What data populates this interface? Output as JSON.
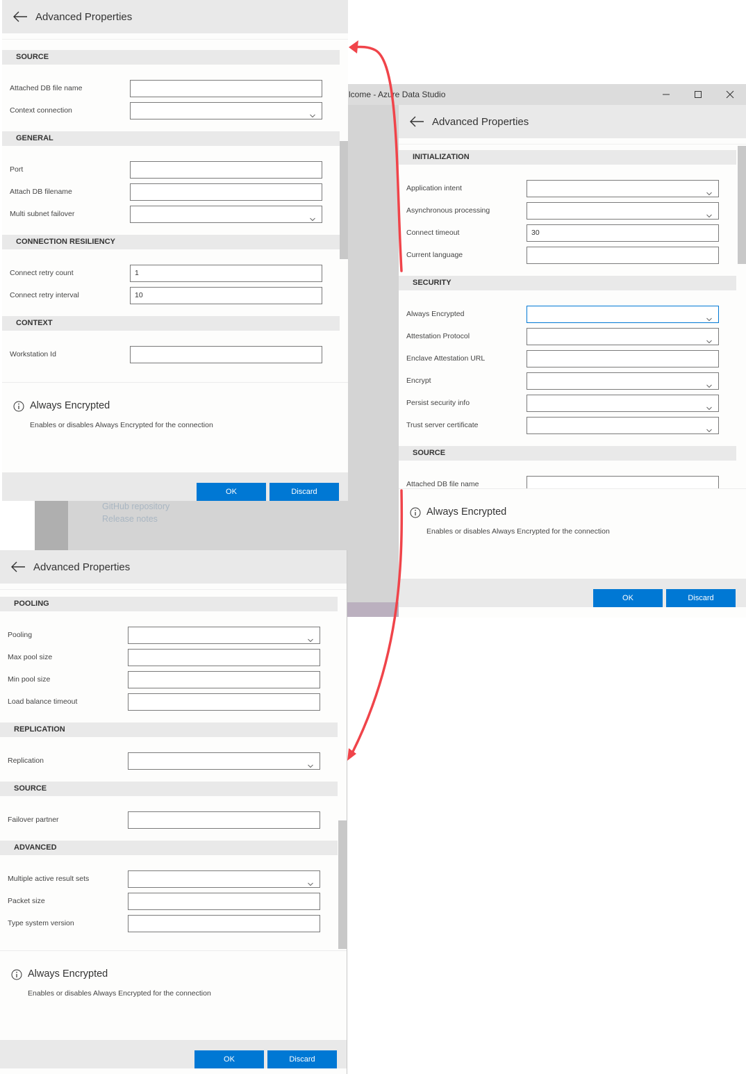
{
  "window": {
    "title": "lcome - Azure Data Studio",
    "controls": [
      "minimize",
      "maximize",
      "close"
    ]
  },
  "background_links": [
    "GitHub repository",
    "Release notes"
  ],
  "panel_title": "Advanced Properties",
  "colors": {
    "accent": "#0078d4",
    "arrow": "#f0444a",
    "section_bg": "#e9e9e9"
  },
  "panels": [
    {
      "id": "top-left",
      "title": "Advanced Properties",
      "sections": [
        {
          "name": "SOURCE",
          "fields": [
            {
              "label": "Attached DB file name",
              "type": "text",
              "value": ""
            },
            {
              "label": "Context connection",
              "type": "select",
              "value": ""
            }
          ]
        },
        {
          "name": "GENERAL",
          "fields": [
            {
              "label": "Port",
              "type": "text",
              "value": ""
            },
            {
              "label": "Attach DB filename",
              "type": "text",
              "value": ""
            },
            {
              "label": "Multi subnet failover",
              "type": "select",
              "value": ""
            }
          ]
        },
        {
          "name": "CONNECTION RESILIENCY",
          "fields": [
            {
              "label": "Connect retry count",
              "type": "text",
              "value": "1"
            },
            {
              "label": "Connect retry interval",
              "type": "text",
              "value": "10"
            }
          ]
        },
        {
          "name": "CONTEXT",
          "fields": [
            {
              "label": "Workstation Id",
              "type": "text",
              "value": ""
            }
          ]
        }
      ],
      "info": {
        "title": "Always Encrypted",
        "description": "Enables or disables Always Encrypted for the connection"
      },
      "ok_label": "OK",
      "discard_label": "Discard"
    },
    {
      "id": "right",
      "title": "Advanced Properties",
      "sections": [
        {
          "name": "INITIALIZATION",
          "fields": [
            {
              "label": "Application intent",
              "type": "select",
              "value": ""
            },
            {
              "label": "Asynchronous processing",
              "type": "select",
              "value": ""
            },
            {
              "label": "Connect timeout",
              "type": "text",
              "value": "30"
            },
            {
              "label": "Current language",
              "type": "text",
              "value": ""
            }
          ]
        },
        {
          "name": "SECURITY",
          "fields": [
            {
              "label": "Always Encrypted",
              "type": "select",
              "value": "",
              "focused": true
            },
            {
              "label": "Attestation Protocol",
              "type": "select",
              "value": ""
            },
            {
              "label": "Enclave Attestation URL",
              "type": "text",
              "value": ""
            },
            {
              "label": "Encrypt",
              "type": "select",
              "value": ""
            },
            {
              "label": "Persist security info",
              "type": "select",
              "value": ""
            },
            {
              "label": "Trust server certificate",
              "type": "select",
              "value": ""
            }
          ]
        },
        {
          "name": "SOURCE",
          "fields": [
            {
              "label": "Attached DB file name",
              "type": "text",
              "value": ""
            }
          ]
        }
      ],
      "info": {
        "title": "Always Encrypted",
        "description": "Enables or disables Always Encrypted for the connection"
      },
      "ok_label": "OK",
      "discard_label": "Discard"
    },
    {
      "id": "bottom-left",
      "title": "Advanced Properties",
      "sections": [
        {
          "name": "POOLING",
          "fields": [
            {
              "label": "Pooling",
              "type": "select",
              "value": ""
            },
            {
              "label": "Max pool size",
              "type": "text",
              "value": ""
            },
            {
              "label": "Min pool size",
              "type": "text",
              "value": ""
            },
            {
              "label": "Load balance timeout",
              "type": "text",
              "value": ""
            }
          ]
        },
        {
          "name": "REPLICATION",
          "fields": [
            {
              "label": "Replication",
              "type": "select",
              "value": ""
            }
          ]
        },
        {
          "name": "SOURCE",
          "fields": [
            {
              "label": "Failover partner",
              "type": "text",
              "value": ""
            }
          ]
        },
        {
          "name": "ADVANCED",
          "fields": [
            {
              "label": "Multiple active result sets",
              "type": "select",
              "value": ""
            },
            {
              "label": "Packet size",
              "type": "text",
              "value": ""
            },
            {
              "label": "Type system version",
              "type": "text",
              "value": ""
            }
          ]
        }
      ],
      "info": {
        "title": "Always Encrypted",
        "description": "Enables or disables Always Encrypted for the connection"
      },
      "ok_label": "OK",
      "discard_label": "Discard"
    }
  ]
}
